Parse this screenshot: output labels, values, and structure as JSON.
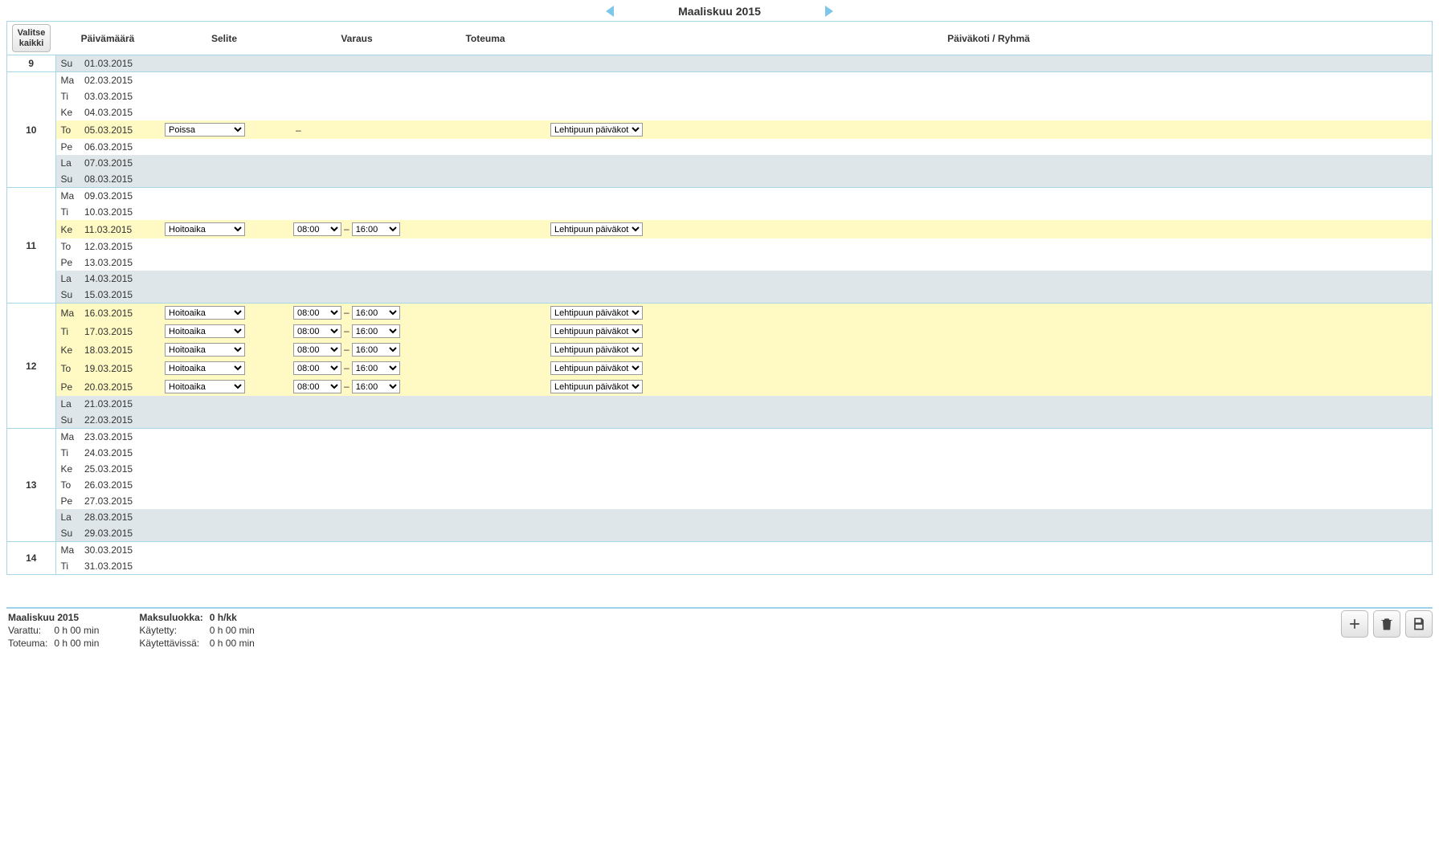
{
  "nav": {
    "title": "Maaliskuu 2015"
  },
  "headers": {
    "select_all": "Valitse kaikki",
    "date": "Päivämäärä",
    "selite": "Selite",
    "varaus": "Varaus",
    "toteuma": "Toteuma",
    "ryhma": "Päiväkoti / Ryhmä"
  },
  "selite_options": {
    "hoitoaika": "Hoitoaika",
    "poissa": "Poissa"
  },
  "times": {
    "t0800": "08:00",
    "t1600": "16:00"
  },
  "ryhma_options": {
    "lehtipuun": "Lehtipuun päiväkoti"
  },
  "dash": "–",
  "weeks": [
    {
      "num": "9",
      "days": [
        {
          "dow": "Su",
          "date": "01.03.2015",
          "bg": "grey"
        }
      ]
    },
    {
      "num": "10",
      "days": [
        {
          "dow": "Ma",
          "date": "02.03.2015",
          "bg": "white"
        },
        {
          "dow": "Ti",
          "date": "03.03.2015",
          "bg": "white"
        },
        {
          "dow": "Ke",
          "date": "04.03.2015",
          "bg": "white"
        },
        {
          "dow": "To",
          "date": "05.03.2015",
          "bg": "yel",
          "selite": "poissa",
          "varaus_dash_only": true,
          "ryhma": "lehtipuun"
        },
        {
          "dow": "Pe",
          "date": "06.03.2015",
          "bg": "white"
        },
        {
          "dow": "La",
          "date": "07.03.2015",
          "bg": "grey"
        },
        {
          "dow": "Su",
          "date": "08.03.2015",
          "bg": "grey"
        }
      ]
    },
    {
      "num": "11",
      "days": [
        {
          "dow": "Ma",
          "date": "09.03.2015",
          "bg": "white"
        },
        {
          "dow": "Ti",
          "date": "10.03.2015",
          "bg": "white"
        },
        {
          "dow": "Ke",
          "date": "11.03.2015",
          "bg": "yel",
          "selite": "hoitoaika",
          "from": "t0800",
          "to": "t1600",
          "ryhma": "lehtipuun"
        },
        {
          "dow": "To",
          "date": "12.03.2015",
          "bg": "white"
        },
        {
          "dow": "Pe",
          "date": "13.03.2015",
          "bg": "white"
        },
        {
          "dow": "La",
          "date": "14.03.2015",
          "bg": "grey"
        },
        {
          "dow": "Su",
          "date": "15.03.2015",
          "bg": "grey"
        }
      ]
    },
    {
      "num": "12",
      "days": [
        {
          "dow": "Ma",
          "date": "16.03.2015",
          "bg": "yel",
          "selite": "hoitoaika",
          "from": "t0800",
          "to": "t1600",
          "ryhma": "lehtipuun"
        },
        {
          "dow": "Ti",
          "date": "17.03.2015",
          "bg": "yel",
          "selite": "hoitoaika",
          "from": "t0800",
          "to": "t1600",
          "ryhma": "lehtipuun"
        },
        {
          "dow": "Ke",
          "date": "18.03.2015",
          "bg": "yel",
          "selite": "hoitoaika",
          "from": "t0800",
          "to": "t1600",
          "ryhma": "lehtipuun"
        },
        {
          "dow": "To",
          "date": "19.03.2015",
          "bg": "yel",
          "selite": "hoitoaika",
          "from": "t0800",
          "to": "t1600",
          "ryhma": "lehtipuun"
        },
        {
          "dow": "Pe",
          "date": "20.03.2015",
          "bg": "yel",
          "selite": "hoitoaika",
          "from": "t0800",
          "to": "t1600",
          "ryhma": "lehtipuun"
        },
        {
          "dow": "La",
          "date": "21.03.2015",
          "bg": "grey"
        },
        {
          "dow": "Su",
          "date": "22.03.2015",
          "bg": "grey"
        }
      ]
    },
    {
      "num": "13",
      "days": [
        {
          "dow": "Ma",
          "date": "23.03.2015",
          "bg": "white"
        },
        {
          "dow": "Ti",
          "date": "24.03.2015",
          "bg": "white"
        },
        {
          "dow": "Ke",
          "date": "25.03.2015",
          "bg": "white"
        },
        {
          "dow": "To",
          "date": "26.03.2015",
          "bg": "white"
        },
        {
          "dow": "Pe",
          "date": "27.03.2015",
          "bg": "white"
        },
        {
          "dow": "La",
          "date": "28.03.2015",
          "bg": "grey"
        },
        {
          "dow": "Su",
          "date": "29.03.2015",
          "bg": "grey"
        }
      ]
    },
    {
      "num": "14",
      "days": [
        {
          "dow": "Ma",
          "date": "30.03.2015",
          "bg": "white"
        },
        {
          "dow": "Ti",
          "date": "31.03.2015",
          "bg": "white"
        }
      ]
    }
  ],
  "footer": {
    "left_title": "Maaliskuu 2015",
    "varattu_label": "Varattu:",
    "varattu_val": "0 h 00 min",
    "toteuma_label": "Toteuma:",
    "toteuma_val": "0 h 00 min",
    "maksu_label": "Maksuluokka:",
    "maksu_val": "0 h/kk",
    "kaytetty_label": "Käytetty:",
    "kaytetty_val": "0 h 00 min",
    "kaytettavissa_label": "Käytettävissä:",
    "kaytettavissa_val": "0 h 00 min"
  }
}
